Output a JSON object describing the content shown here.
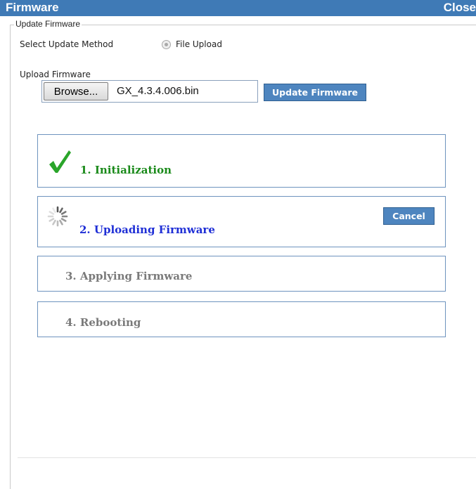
{
  "window": {
    "title": "Firmware",
    "close_label": "Close"
  },
  "update": {
    "legend": "Update Firmware",
    "method_label": "Select Update Method",
    "method_option": "File Upload",
    "upload_label": "Upload Firmware",
    "browse_label": "Browse...",
    "file_name": "GX_4.3.4.006.bin",
    "update_button": "Update Firmware"
  },
  "steps": [
    {
      "label": "1. Initialization",
      "status": "complete",
      "color": "#1a8a1a"
    },
    {
      "label": "2. Uploading Firmware",
      "status": "in-progress",
      "color": "#1f2fd6",
      "cancel_label": "Cancel"
    },
    {
      "label": "3. Applying Firmware",
      "status": "pending",
      "color": "#7a7a7a"
    },
    {
      "label": "4. Rebooting",
      "status": "pending",
      "color": "#7a7a7a"
    }
  ],
  "colors": {
    "accent": "#3f7ab6",
    "button": "#4e85bf",
    "step_border": "#6e93be"
  }
}
